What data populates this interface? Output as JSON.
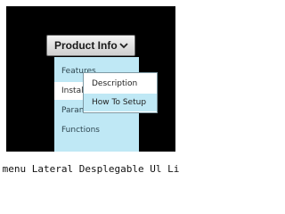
{
  "menu": {
    "button_label": "Product Info",
    "button_icon": "chevron-down-icon",
    "items": [
      {
        "label": "Features"
      },
      {
        "label": "Installation"
      },
      {
        "label": "Parameters"
      },
      {
        "label": "Functions"
      }
    ],
    "flyout": [
      {
        "label": "Description"
      },
      {
        "label": "How To Setup"
      }
    ]
  },
  "caption": "menu Lateral Desplegable Ul Li",
  "colors": {
    "stage": "#000000",
    "submenu": "#bfe8f5",
    "active_item": "#ffffff",
    "button_top": "#f4f4f4",
    "button_bottom": "#cfcfcf"
  }
}
